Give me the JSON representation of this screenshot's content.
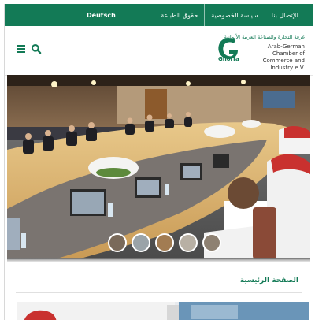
{
  "topbar": {
    "language_label": "Deutsch",
    "links": [
      "حقوق الطباعة",
      "سياسة الخصوصية",
      "للإتصال بنا"
    ]
  },
  "header": {
    "menu_icon": "hamburger-icon",
    "search_icon": "search-icon",
    "logo": {
      "arabic_name": "غرفة التجارة والصناعة العربية الألمانية",
      "english_name": "Arab-German Chamber of Commerce and Industry e.V.",
      "wordmark": "Ghorfa"
    }
  },
  "hero": {
    "description_icon": "conference-photo",
    "slides": 5,
    "current_slide": 1
  },
  "main": {
    "breadcrumb": "الصفحة الرئيسية"
  },
  "colors": {
    "brand_green": "#137a56",
    "white": "#ffffff"
  }
}
